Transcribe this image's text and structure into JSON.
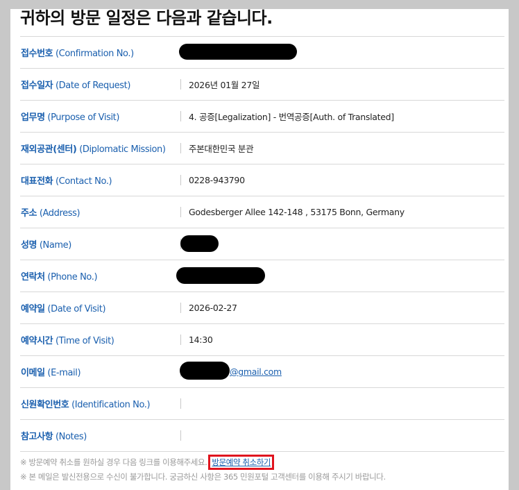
{
  "title": "귀하의 방문 일정은 다음과 같습니다.",
  "rows": [
    {
      "label_ko": "접수번호",
      "label_en": "(Confirmation No.)",
      "value": ""
    },
    {
      "label_ko": "접수일자",
      "label_en": "(Date of Request)",
      "value": "2026년 01월 27일"
    },
    {
      "label_ko": "업무명",
      "label_en": "(Purpose of Visit)",
      "value": "4. 공증[Legalization] - 번역공증[Auth. of Translated]"
    },
    {
      "label_ko": "재외공관(센터)",
      "label_en": "(Diplomatic Mission)",
      "value": "주본대한민국 분관"
    },
    {
      "label_ko": "대표전화",
      "label_en": "(Contact No.)",
      "value": "0228-943790"
    },
    {
      "label_ko": "주소",
      "label_en": "(Address)",
      "value": "Godesberger Allee 142-148 , 53175 Bonn, Germany"
    },
    {
      "label_ko": "성명",
      "label_en": "(Name)",
      "value": ""
    },
    {
      "label_ko": "연락처",
      "label_en": "(Phone No.)",
      "value": ""
    },
    {
      "label_ko": "예약일",
      "label_en": "(Date of Visit)",
      "value": "2026-02-27"
    },
    {
      "label_ko": "예약시간",
      "label_en": "(Time of Visit)",
      "value": "14:30"
    },
    {
      "label_ko": "이메일",
      "label_en": "(E-mail)",
      "value": "@gmail.com"
    },
    {
      "label_ko": "신원확인번호",
      "label_en": "(Identification No.)",
      "value": ""
    },
    {
      "label_ko": "참고사항",
      "label_en": "(Notes)",
      "value": ""
    }
  ],
  "notes": {
    "cancel_prefix": "※ 방문예약 취소를 원하실 경우 다음 링크를 이용해주세요.",
    "cancel_link": "방문예약 취소하기",
    "noreply": "※ 본 메일은 발신전용으로 수신이 불가합니다. 궁금하신 사항은 365 민원포털 고객센터를 이용해 주시기 바랍니다."
  },
  "colors": {
    "label": "#1a5fae",
    "highlight_box": "#e0141e"
  }
}
